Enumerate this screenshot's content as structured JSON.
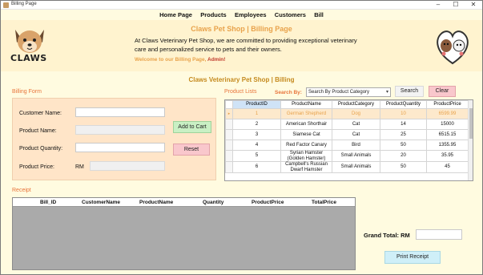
{
  "window": {
    "title": "Billing Page",
    "controls": [
      "–",
      "☐",
      "✕"
    ]
  },
  "menu": {
    "items": [
      "Home Page",
      "Products",
      "Employees",
      "Customers",
      "Bill"
    ]
  },
  "header": {
    "logo_text": "CLAWS",
    "title": "Claws Pet Shop | Billing Page",
    "description": "At Claws Veterinary Pet Shop, we are committed to providing exceptional veterinary care and personalized service to pets and their owners.",
    "welcome_prefix": "Welcome to our Billing Page,",
    "welcome_user": "Admin!"
  },
  "subtitle": "Claws Veterinary Pet Shop | Billing",
  "billing_form": {
    "section_label": "Billing Form",
    "customer_name_label": "Customer Name:",
    "customer_name_value": "",
    "product_name_label": "Product Name:",
    "product_name_value": "",
    "product_quantity_label": "Product Quantity:",
    "product_quantity_value": "",
    "product_price_label": "Product Price:",
    "currency": "RM",
    "product_price_value": "",
    "add_button": "Add to Cart",
    "reset_button": "Reset"
  },
  "product_lists": {
    "section_label": "Product Lists",
    "search_by_label": "Search By:",
    "search_by_selected": "Search By Product Category",
    "search_button": "Search",
    "clear_button": "Clear",
    "columns": [
      "ProductID",
      "ProductName",
      "ProductCategory",
      "ProductQuantity",
      "ProductPrice"
    ],
    "rows": [
      {
        "id": "1",
        "name": "German Shepherd",
        "category": "Dog",
        "quantity": "10",
        "price": "6599.99",
        "selected": true
      },
      {
        "id": "2",
        "name": "American Shorthair",
        "category": "Cat",
        "quantity": "14",
        "price": "15000",
        "selected": false
      },
      {
        "id": "3",
        "name": "Siamese Cat",
        "category": "Cat",
        "quantity": "25",
        "price": "6515.15",
        "selected": false
      },
      {
        "id": "4",
        "name": "Red Factor Canary",
        "category": "Bird",
        "quantity": "50",
        "price": "1355.95",
        "selected": false
      },
      {
        "id": "5",
        "name": "Syrian Hamster (Golden Hamster)",
        "category": "Small Animals",
        "quantity": "20",
        "price": "35.95",
        "selected": false
      },
      {
        "id": "6",
        "name": "Campbell's Russian Dwarf Hamster",
        "category": "Small Animals",
        "quantity": "50",
        "price": "45",
        "selected": false
      }
    ]
  },
  "receipt": {
    "section_label": "Receipt",
    "columns": [
      "Bill_ID",
      "CustomerName",
      "ProductName",
      "Quantity",
      "ProductPrice",
      "TotalPrice"
    ],
    "grand_total_label": "Grand Total:",
    "currency": "RM",
    "grand_total_value": "",
    "print_button": "Print Receipt"
  }
}
